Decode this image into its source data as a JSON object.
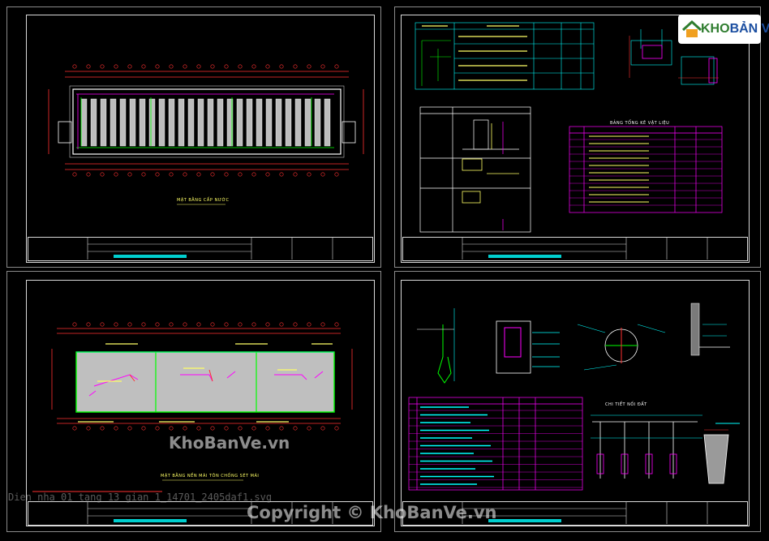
{
  "sheets": [
    {
      "id": "s1",
      "caption": "MẶT BẰNG CẤP NƯỚC"
    },
    {
      "id": "s2",
      "caption": "BẢNG TỔNG KÊ VẬT LIỆU"
    },
    {
      "id": "s3",
      "caption": "MẶT BẰNG NỀN MÁI TÔN CHỐNG SÉT MÁI"
    },
    {
      "id": "s4",
      "caption": "CHI TIẾT NỐI ĐẤT"
    }
  ],
  "watermark": {
    "site_mid": "KhoBanVe.vn",
    "copyright": "Copyright © KhoBanVe.vn",
    "filename": "Dien nha 01 tang 13 gian 1_14701_2405daf1.svg"
  },
  "logo": {
    "brand_a": "KHO",
    "brand_b": "BẢN VẼ"
  },
  "colors": {
    "frame": "#d9d9d9",
    "cyan": "#00ffff",
    "magenta": "#ff00ff",
    "red": "#ff3030",
    "green": "#00ff00",
    "yellow": "#ffff66"
  }
}
